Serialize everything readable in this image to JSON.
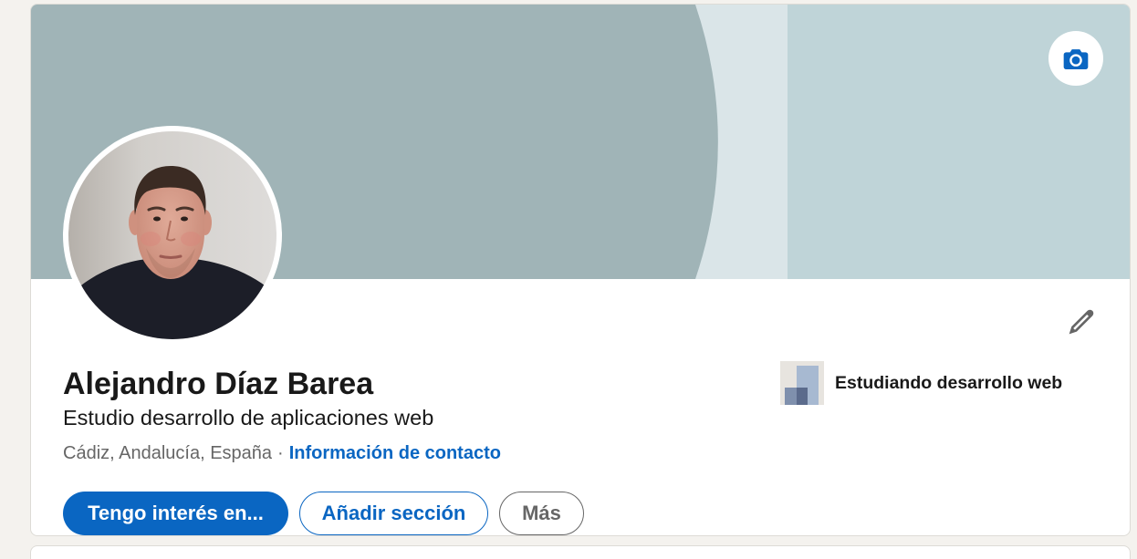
{
  "cover": {
    "colors": {
      "primary": "#a0b4b7",
      "stripe": "#dae5e8",
      "secondary": "#bfd4d8"
    },
    "camera_button_icon": "camera-icon"
  },
  "top_card": {
    "name": "Alejandro Díaz Barea",
    "headline": "Estudio desarrollo de aplicaciones web",
    "location": "Cádiz, Andalucía, España",
    "separator": "·",
    "contact_info_link": "Información de contacto",
    "edit_icon": "pencil-icon"
  },
  "education": {
    "label": "Estudiando desarrollo web"
  },
  "actions": {
    "open_to": "Tengo interés en...",
    "add_section": "Añadir sección",
    "more": "Más"
  },
  "colors": {
    "page_background": "#f4f2ee",
    "card_background": "#ffffff",
    "accent": "#0a66c2",
    "text_primary": "#191919",
    "text_secondary": "#666666"
  }
}
